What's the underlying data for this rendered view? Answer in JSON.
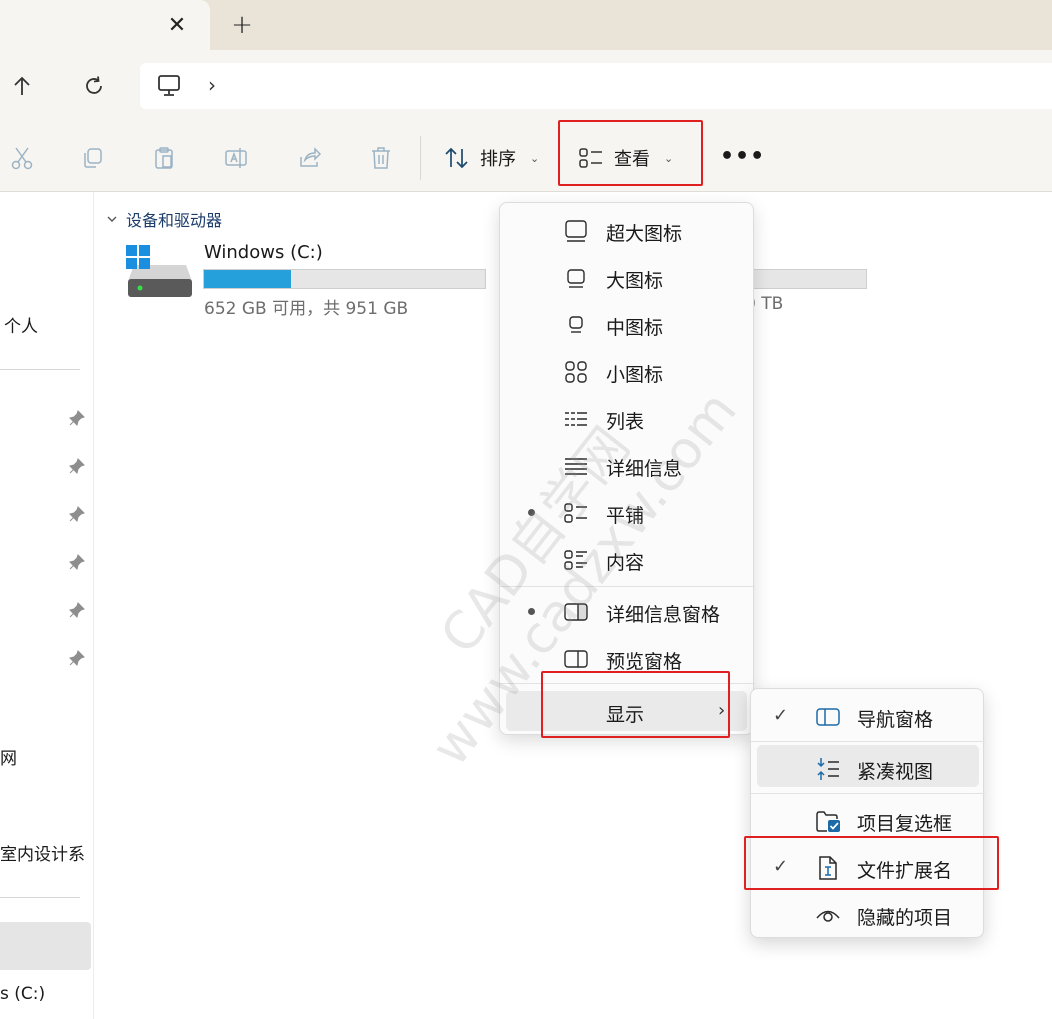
{
  "colors": {
    "accent": "#26a0da",
    "highlight_box": "#e02020",
    "group_header": "#1c3d6b"
  },
  "tabs": {
    "close_icon": "close-icon",
    "new_tab_icon": "plus-icon",
    "close_glyph": "✕",
    "new_glyph": "+"
  },
  "address": {
    "chevron": "›"
  },
  "toolbar": {
    "sort_label": "排序",
    "view_label": "查看",
    "chevron": "⌄",
    "more_label": "•••"
  },
  "sidebar": {
    "personal": "个人",
    "network": "网",
    "interior": "室内设计系",
    "drive": "s (C:)"
  },
  "content": {
    "group_title": "设备和驱动器",
    "drives": [
      {
        "name": "Windows (C:)",
        "info": "652 GB 可用，共 951 GB",
        "used_fraction": 0.31
      },
      {
        "info": "0 TB"
      }
    ]
  },
  "view_menu": {
    "items": [
      {
        "label": "超大图标",
        "icon": "extra-large-icons-icon"
      },
      {
        "label": "大图标",
        "icon": "large-icons-icon"
      },
      {
        "label": "中图标",
        "icon": "medium-icons-icon"
      },
      {
        "label": "小图标",
        "icon": "small-icons-icon"
      },
      {
        "label": "列表",
        "icon": "list-icon"
      },
      {
        "label": "详细信息",
        "icon": "details-icon"
      },
      {
        "label": "平铺",
        "icon": "tiles-icon",
        "selected": true
      },
      {
        "label": "内容",
        "icon": "content-icon"
      },
      {
        "label": "详细信息窗格",
        "icon": "details-pane-icon",
        "selected": true
      },
      {
        "label": "预览窗格",
        "icon": "preview-pane-icon"
      },
      {
        "label": "显示",
        "has_submenu": true
      }
    ],
    "arrow": "›"
  },
  "show_menu": {
    "items": [
      {
        "label": "导航窗格",
        "checked": true,
        "icon": "navigation-pane-icon"
      },
      {
        "label": "紧凑视图",
        "checked": false,
        "icon": "compact-view-icon"
      },
      {
        "label": "项目复选框",
        "checked": false,
        "icon": "item-checkbox-icon"
      },
      {
        "label": "文件扩展名",
        "checked": true,
        "icon": "file-extension-icon"
      },
      {
        "label": "隐藏的项目",
        "checked": false,
        "icon": "hidden-items-icon"
      }
    ],
    "check_glyph": "✓"
  },
  "watermark": {
    "line1": "CAD自学网",
    "line2": "www.cadzxw.com"
  }
}
